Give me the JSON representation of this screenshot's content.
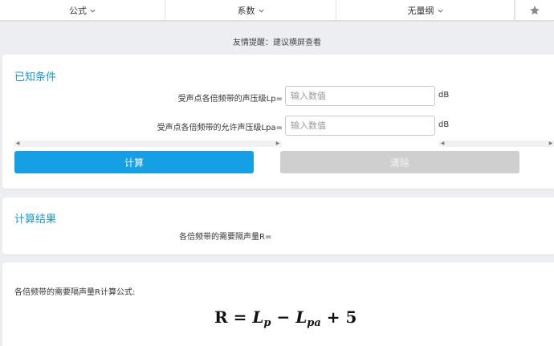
{
  "tabs": [
    {
      "label": "公式"
    },
    {
      "label": "系数"
    },
    {
      "label": "无量纲"
    }
  ],
  "hint": "友情提醒：建议横屏查看",
  "known": {
    "title": "已知条件",
    "fields": [
      {
        "label": "受声点各倍频带的声压级Lp=",
        "placeholder": "输入数值",
        "value": "",
        "unit": "dB"
      },
      {
        "label": "受声点各倍频带的允许声压级Lpa=",
        "placeholder": "输入数值",
        "value": "",
        "unit": "dB"
      }
    ],
    "calc_label": "计算",
    "clear_label": "清除"
  },
  "result": {
    "title": "计算结果",
    "label": "各倍频带的需要隔声量R="
  },
  "formula": {
    "title": "各倍频带的需要隔声量R计算公式:",
    "lhs": "R",
    "eq": "=",
    "t1": "L",
    "t1sub": "p",
    "op1": "−",
    "t2": "L",
    "t2sub": "pa",
    "op2": "+",
    "const": "5"
  },
  "colors": {
    "accent": "#159fe4",
    "title": "#1797d6",
    "disabled": "#cfcfcf"
  },
  "icons": {
    "tab_chevron": "chevron-down-icon",
    "favorite": "star-icon"
  }
}
